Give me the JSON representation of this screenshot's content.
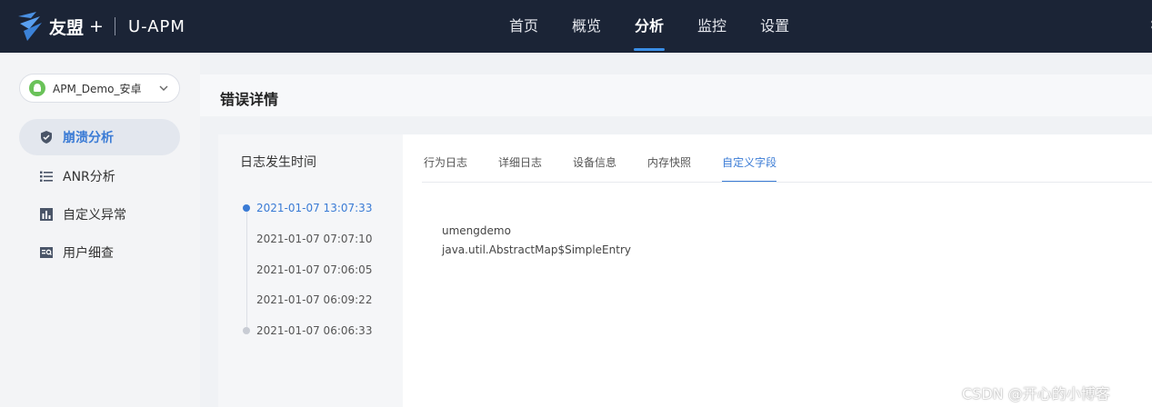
{
  "header": {
    "brand": "友盟",
    "brand_plus": "+",
    "product": "U-APM",
    "nav": [
      {
        "label": "首页",
        "active": false
      },
      {
        "label": "概览",
        "active": false
      },
      {
        "label": "分析",
        "active": true
      },
      {
        "label": "监控",
        "active": false
      },
      {
        "label": "设置",
        "active": false
      }
    ],
    "accent_color": "#3a8ee6"
  },
  "sidebar": {
    "app_selector": {
      "value": "APM_Demo_安卓",
      "icon": "android-icon"
    },
    "items": [
      {
        "label": "崩溃分析",
        "icon": "shield-icon",
        "active": true
      },
      {
        "label": "ANR分析",
        "icon": "list-icon",
        "active": false
      },
      {
        "label": "自定义异常",
        "icon": "bar-chart-icon",
        "active": false
      },
      {
        "label": "用户细查",
        "icon": "user-search-icon",
        "active": false
      }
    ]
  },
  "main": {
    "title": "错误详情",
    "log_time_header": "日志发生时间",
    "timeline": [
      {
        "time": "2021-01-07 13:07:33",
        "active": true
      },
      {
        "time": "2021-01-07 07:07:10",
        "active": false
      },
      {
        "time": "2021-01-07 07:06:05",
        "active": false
      },
      {
        "time": "2021-01-07 06:09:22",
        "active": false
      },
      {
        "time": "2021-01-07 06:06:33",
        "active": false
      }
    ],
    "tabs": [
      {
        "label": "行为日志",
        "active": false
      },
      {
        "label": "详细日志",
        "active": false
      },
      {
        "label": "设备信息",
        "active": false
      },
      {
        "label": "内存快照",
        "active": false
      },
      {
        "label": "自定义字段",
        "active": true
      }
    ],
    "custom_fields": [
      "umengdemo",
      "java.util.AbstractMap$SimpleEntry"
    ]
  },
  "watermark": "CSDN @开心的小博客"
}
